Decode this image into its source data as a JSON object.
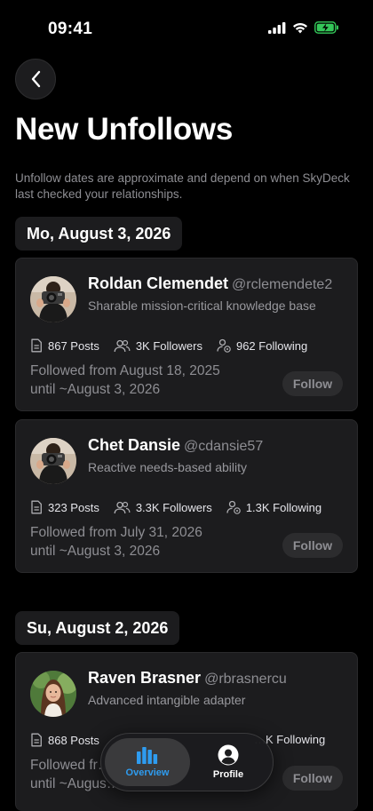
{
  "status_bar": {
    "time": "09:41"
  },
  "header": {
    "title": "New Unfollows",
    "description": "Unfollow dates are approximate and depend on when SkyDeck last checked your relationships."
  },
  "groups": [
    {
      "date": "Mo, August 3, 2026",
      "users": [
        {
          "name": "Roldan Clemendet",
          "handle": "@rclemendete2",
          "bio": "Sharable mission-critical knowledge base",
          "posts": "867 Posts",
          "followers": "3K Followers",
          "following": "962 Following",
          "followed_from": "Followed from August 18, 2025",
          "until": "until ~August 3, 2026",
          "action": "Follow"
        },
        {
          "name": "Chet Dansie",
          "handle": "@cdansie57",
          "bio": "Reactive needs-based ability",
          "posts": "323 Posts",
          "followers": "3.3K Followers",
          "following": "1.3K Following",
          "followed_from": "Followed from July 31, 2026",
          "until": "until ~August 3, 2026",
          "action": "Follow"
        }
      ]
    },
    {
      "date": "Su, August 2, 2026",
      "users": [
        {
          "name": "Raven Brasner",
          "handle": "@rbrasnercu",
          "bio": "Advanced intangible adapter",
          "posts": "868 Posts",
          "followers": "",
          "following": "…K Following",
          "followed_from": "Followed fr…",
          "until": "until ~Augus…",
          "action": "Follow"
        }
      ]
    }
  ],
  "tabbar": {
    "overview": "Overview",
    "profile": "Profile"
  },
  "colors": {
    "accent": "#2e9cf0",
    "battery": "#34c759",
    "background": "#000000",
    "card": "#1c1c1e"
  }
}
